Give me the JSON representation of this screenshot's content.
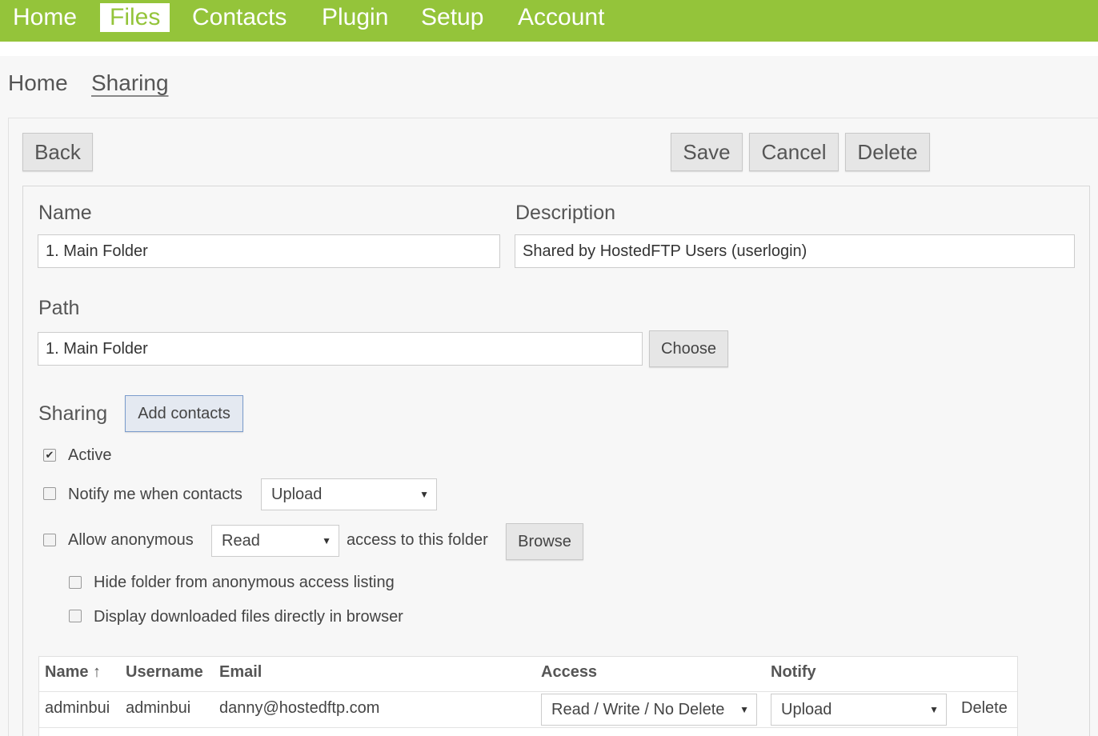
{
  "topnav": {
    "items": [
      {
        "label": "Home"
      },
      {
        "label": "Files",
        "active": true
      },
      {
        "label": "Contacts"
      },
      {
        "label": "Plugin"
      },
      {
        "label": "Setup"
      },
      {
        "label": "Account"
      }
    ]
  },
  "breadcrumb": {
    "home": "Home",
    "current": "Sharing"
  },
  "toolbar": {
    "back": "Back",
    "save": "Save",
    "cancel": "Cancel",
    "delete": "Delete"
  },
  "form": {
    "name_label": "Name",
    "name_value": "1. Main Folder",
    "description_label": "Description",
    "description_value": "Shared by HostedFTP Users (userlogin)",
    "path_label": "Path",
    "path_value": "1. Main Folder",
    "choose": "Choose",
    "sharing_label": "Sharing",
    "add_contacts": "Add contacts"
  },
  "options": {
    "active_label": "Active",
    "active_checked": true,
    "notify_label": "Notify me when contacts",
    "notify_select": "Upload",
    "anon_label": "Allow anonymous",
    "anon_select": "Read",
    "anon_suffix": "access to this folder",
    "browse": "Browse",
    "hide_label": "Hide folder from anonymous access listing",
    "display_label": "Display downloaded files directly in browser"
  },
  "table": {
    "headers": {
      "name": "Name ↑",
      "username": "Username",
      "email": "Email",
      "access": "Access",
      "notify": "Notify"
    },
    "rows": [
      {
        "name": "adminbui",
        "username": "adminbui",
        "email": "danny@hostedftp.com",
        "access": "Read / Write / No Delete",
        "notify": "Upload",
        "action": "Delete"
      }
    ]
  },
  "colors": {
    "brand_green": "#94c43a"
  }
}
